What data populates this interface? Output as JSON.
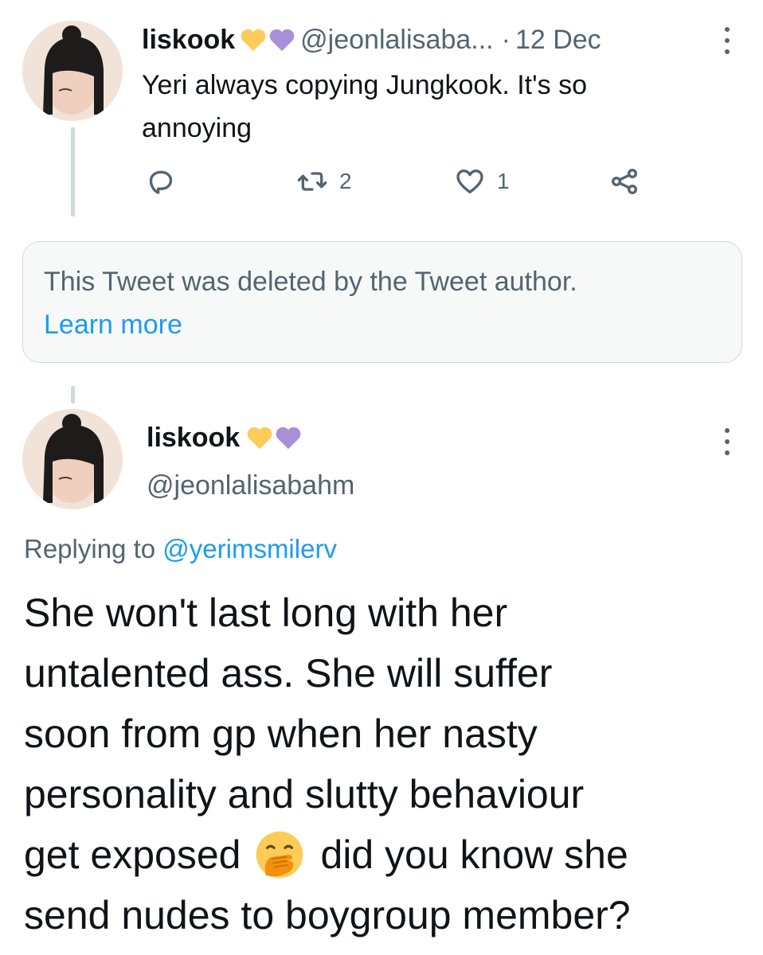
{
  "tweet1": {
    "display_name": "liskook",
    "badges": [
      "yellow-heart",
      "purple-heart"
    ],
    "handle": "@jeonlalisaba...",
    "separator": "·",
    "date": "12 Dec",
    "text_line1": "Yeri always copying Jungkook. It's so",
    "text_line2": "annoying",
    "actions": {
      "retweets": "2",
      "likes": "1"
    }
  },
  "deleted_notice": {
    "text": "This Tweet was deleted by the Tweet author.",
    "link": "Learn more"
  },
  "tweet2": {
    "display_name": "liskook",
    "badges": [
      "yellow-heart",
      "purple-heart"
    ],
    "handle": "@jeonlalisabahm",
    "replying_prefix": "Replying to",
    "replying_handle": "@yerimsmilerv",
    "body_lines": [
      "She won't last long with her",
      "untalented ass. She will suffer",
      "soon from gp when her nasty",
      "personality and slutty behaviour",
      "get exposed",
      "did you know she",
      "send nudes to boygroup member?"
    ],
    "emoji": "face-with-hand-over-mouth"
  },
  "colors": {
    "accent": "#1d9bf0",
    "text": "#0f1419",
    "secondary": "#536471",
    "heart_yellow": "#fdcb58",
    "heart_purple": "#aa8ed6"
  }
}
